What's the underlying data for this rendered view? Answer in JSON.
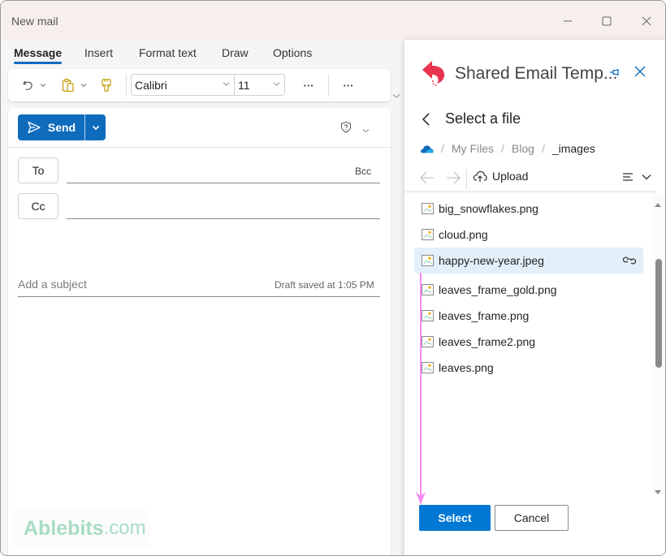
{
  "window": {
    "title": "New mail",
    "controls": [
      "minimize",
      "maximize",
      "close"
    ]
  },
  "ribbon": {
    "tabs": [
      {
        "label": "Message",
        "active": true
      },
      {
        "label": "Insert",
        "active": false
      },
      {
        "label": "Format text",
        "active": false
      },
      {
        "label": "Draw",
        "active": false
      },
      {
        "label": "Options",
        "active": false
      }
    ],
    "font_name": "Calibri",
    "font_size": "11",
    "more_label": "···",
    "icons": [
      "undo-icon",
      "clipboard-icon",
      "format-painter-icon"
    ],
    "icon_accent": "#c19c00"
  },
  "compose": {
    "send_label": "Send",
    "to_label": "To",
    "cc_label": "Cc",
    "bcc_label": "Bcc",
    "to_value": "",
    "cc_value": "",
    "subject_placeholder": "Add a subject",
    "subject_value": "",
    "draft_status": "Draft saved at 1:05 PM",
    "accent": "#0f6cbd"
  },
  "watermark": {
    "brand": "Ablebits",
    "suffix": ".com",
    "color": "#a8dcc3"
  },
  "pane": {
    "title": "Shared Email Temp...",
    "logo_color": "#e8344e",
    "subtitle": "Select a file",
    "breadcrumb": [
      {
        "label": "My Files",
        "current": false
      },
      {
        "label": "Blog",
        "current": false
      },
      {
        "label": "_images",
        "current": true
      }
    ],
    "upload_label": "Upload",
    "files": [
      {
        "name": "big_snowflakes.png",
        "selected": false
      },
      {
        "name": "cloud.png",
        "selected": false
      },
      {
        "name": "happy-new-year.jpeg",
        "selected": true
      },
      {
        "name": "leaves_frame_gold.png",
        "selected": false
      },
      {
        "name": "leaves_frame.png",
        "selected": false
      },
      {
        "name": "leaves_frame2.png",
        "selected": false
      },
      {
        "name": "leaves.png",
        "selected": false
      }
    ],
    "scroll_position": 0.25,
    "select_label": "Select",
    "cancel_label": "Cancel",
    "select_color": "#0078d4",
    "selected_row_color": "#e3eff9",
    "annotation_color": "#f78cf6"
  }
}
